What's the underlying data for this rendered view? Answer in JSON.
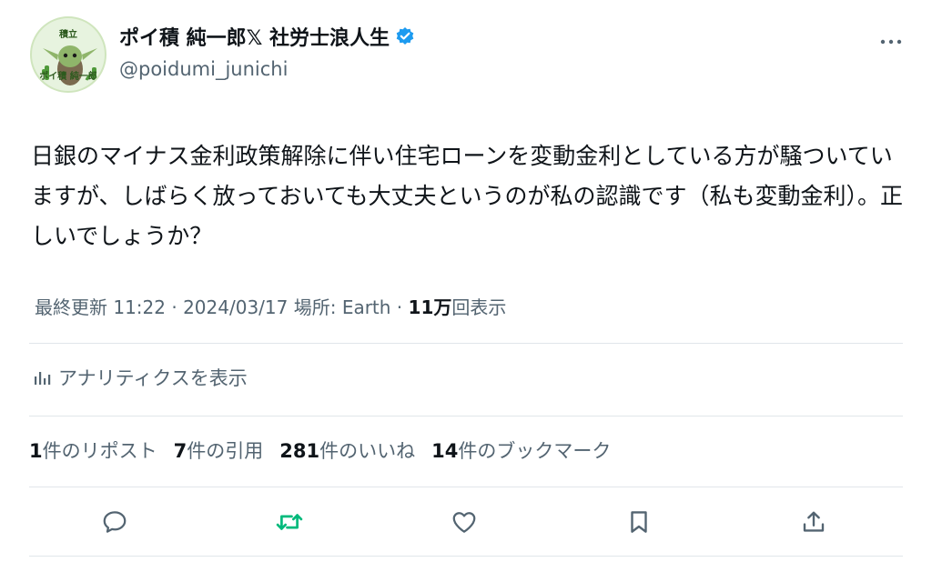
{
  "author": {
    "avatar_text_top": "積立",
    "avatar_text_bottom": "ポイ積 純一郎",
    "display_name": "ポイ積 純一郎𝕏 社労士浪人生",
    "handle": "@poidumi_junichi",
    "verified": true
  },
  "tweet": {
    "text": "日銀のマイナス金利政策解除に伴い住宅ローンを変動金利としている方が騒ついていますが、しばらく放っておいても大丈夫というのが私の認識です（私も変動金利）。正しいでしょうか？"
  },
  "meta": {
    "updated_label": "最終更新 11:22",
    "separator": " · ",
    "date": "2024/03/17",
    "location_label": "場所: Earth",
    "views_count": "11万",
    "views_label": "回表示"
  },
  "analytics": {
    "label": "アナリティクスを表示"
  },
  "stats": {
    "reposts_num": "1",
    "reposts_label": "件のリポスト",
    "quotes_num": "7",
    "quotes_label": "件の引用",
    "likes_num": "281",
    "likes_label": "件のいいね",
    "bookmarks_num": "14",
    "bookmarks_label": "件のブックマーク"
  },
  "icons": {
    "reply": "reply-icon",
    "repost": "repost-icon",
    "like": "like-icon",
    "bookmark": "bookmark-icon",
    "share": "share-icon"
  },
  "colors": {
    "text": "#0f1419",
    "secondary": "#536471",
    "verified": "#1d9bf0",
    "repost_active": "#00ba7c",
    "divider": "#e1e6ea"
  }
}
